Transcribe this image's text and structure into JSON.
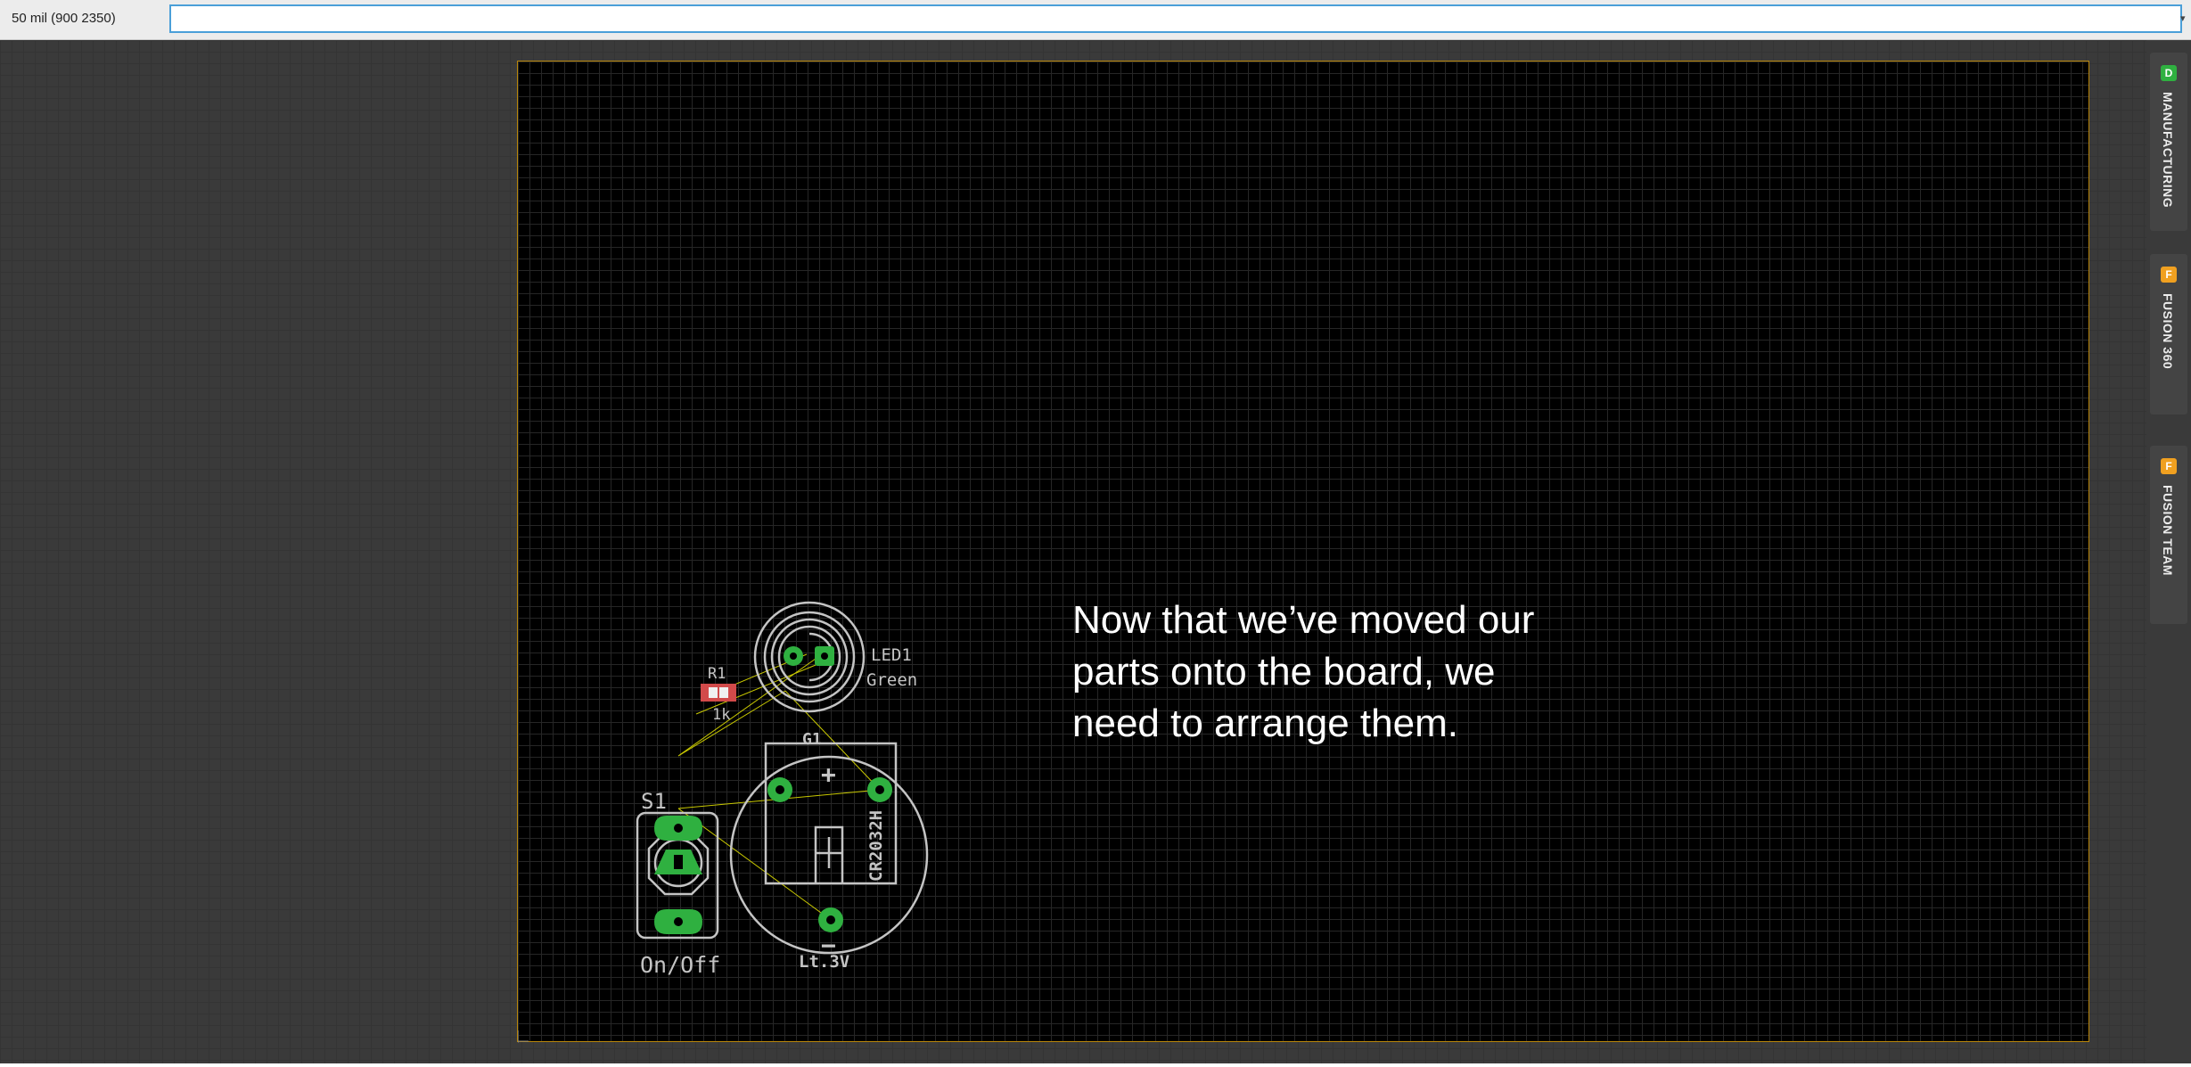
{
  "toolbar": {
    "coordinates": "50 mil (900 2350)",
    "command_value": "",
    "command_placeholder": ""
  },
  "board": {
    "parts": {
      "led": {
        "name": "LED1",
        "value": "Green"
      },
      "resistor": {
        "name": "R1",
        "value": "1k"
      },
      "battery": {
        "name": "G1",
        "model": "CR2032H",
        "voltage": "Lt.3V",
        "plus": "+",
        "minus": "−"
      },
      "switch": {
        "name": "S1",
        "value": "On/Off"
      }
    },
    "colors": {
      "pad": "#2fb040",
      "silkscreen": "#c4c4c4",
      "airwire": "#c8c800",
      "outline": "#b8860b",
      "resistor_body": "#d24a4a"
    }
  },
  "caption": {
    "line1": "Now that we’ve moved our",
    "line2": "parts onto the board, we",
    "line3": "need to arrange them."
  },
  "side_panel": {
    "manufacturing": {
      "label": "MANUFACTURING",
      "icon": "manufacturing-icon",
      "badge": "D",
      "color": "#2fb040"
    },
    "fusion360": {
      "label": "FUSION 360",
      "icon": "fusion360-icon",
      "badge": "F",
      "color": "#f0a020"
    },
    "fusion_team": {
      "label": "FUSION TEAM",
      "icon": "fusion-team-icon",
      "badge": "F",
      "color": "#f0a020"
    }
  }
}
